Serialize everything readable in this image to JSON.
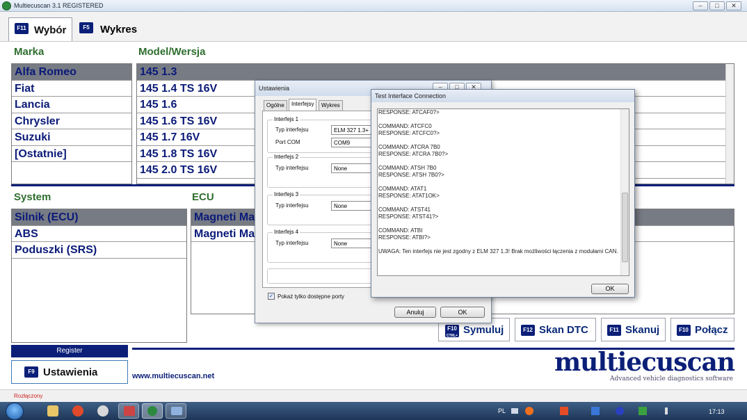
{
  "window": {
    "title": "Multiecuscan 3.1 REGISTERED",
    "min_icon": "minimize-icon",
    "max_icon": "maximize-icon",
    "close_icon": "close-icon"
  },
  "tabs": [
    {
      "key": "F11",
      "label": "Wybór"
    },
    {
      "key": "F5",
      "label": "Wykres"
    }
  ],
  "marka": {
    "header": "Marka",
    "items": [
      "Alfa Romeo",
      "Fiat",
      "Lancia",
      "Chrysler",
      "Suzuki",
      "[Ostatnie]"
    ],
    "selected": 0
  },
  "model": {
    "header": "Model/Wersja",
    "items": [
      "145 1.3",
      "145 1.4 TS 16V",
      "145 1.6",
      "145 1.6 TS 16V",
      "145 1.7 16V",
      "145 1.8 TS 16V",
      "145 2.0 TS 16V"
    ],
    "selected": 0
  },
  "system": {
    "header": "System",
    "items": [
      "Silnik (ECU)",
      "ABS",
      "Poduszki (SRS)"
    ],
    "selected": 0
  },
  "ecu": {
    "header": "ECU",
    "items": [
      "Magneti Ma",
      "Magneti Ma"
    ]
  },
  "ustawienia_dialog": {
    "title": "Ustawienia",
    "tabs": [
      "Ogólne",
      "Interfejsy",
      "Wykres"
    ],
    "group1": {
      "title": "Interfejs 1",
      "type_label": "Typ interfejsu",
      "type_value": "ELM 327 1.3+",
      "port_label": "Port COM",
      "port_value": "COM9"
    },
    "group2": {
      "title": "Interfejs 2",
      "type_label": "Typ interfejsu",
      "type_value": "None"
    },
    "group3": {
      "title": "Interfejs 3",
      "type_label": "Typ interfejsu",
      "type_value": "None"
    },
    "group4": {
      "title": "Interfejs 4",
      "type_label": "Typ interfejsu",
      "type_value": "None"
    },
    "checkbox_label": "Pokaż tylko dostępne porty",
    "checkbox_checked": true,
    "cancel_label": "Anuluj",
    "ok_label": "OK"
  },
  "test_dialog": {
    "title": "Test Interface Connection",
    "log": "RESPONSE: ATCAF0?>\n\nCOMMAND: ATCFC0\nRESPONSE: ATCFC0?>\n\nCOMMAND: ATCRA 7B0\nRESPONSE: ATCRA 7B0?>\n\nCOMMAND: ATSH 7B0\nRESPONSE: ATSH 7B0?>\n\nCOMMAND: ATAT1\nRESPONSE: ATAT1OK>\n\nCOMMAND: ATST41\nRESPONSE: ATST41?>\n\nCOMMAND: ATBI\nRESPONSE: ATBI?>\n\nUWAGA: Ten interfejs nie jest zgodny z ELM 327 1.3! Brak możliwości łączenia z modułami CAN.",
    "ok_label": "OK"
  },
  "actions": [
    {
      "key": "F10",
      "key_sub": "CTRL+",
      "label": "Symuluj"
    },
    {
      "key": "F12",
      "label": "Skan DTC"
    },
    {
      "key": "F11",
      "label": "Skanuj"
    },
    {
      "key": "F10",
      "label": "Połącz"
    }
  ],
  "register_label": "Register",
  "settings": {
    "key": "F9",
    "label": "Ustawienia"
  },
  "website": "www.multiecuscan.net",
  "logo": {
    "name": "multiecuscan",
    "tagline": "Advanced vehicle diagnostics software"
  },
  "status": "Rozłączony",
  "taskbar": {
    "lang": "PL",
    "time": "17:13"
  },
  "colors": {
    "navy": "#0b1f78",
    "green_header": "#2e6e2e",
    "selected_row": "#777b84",
    "status_red": "#d02020"
  }
}
